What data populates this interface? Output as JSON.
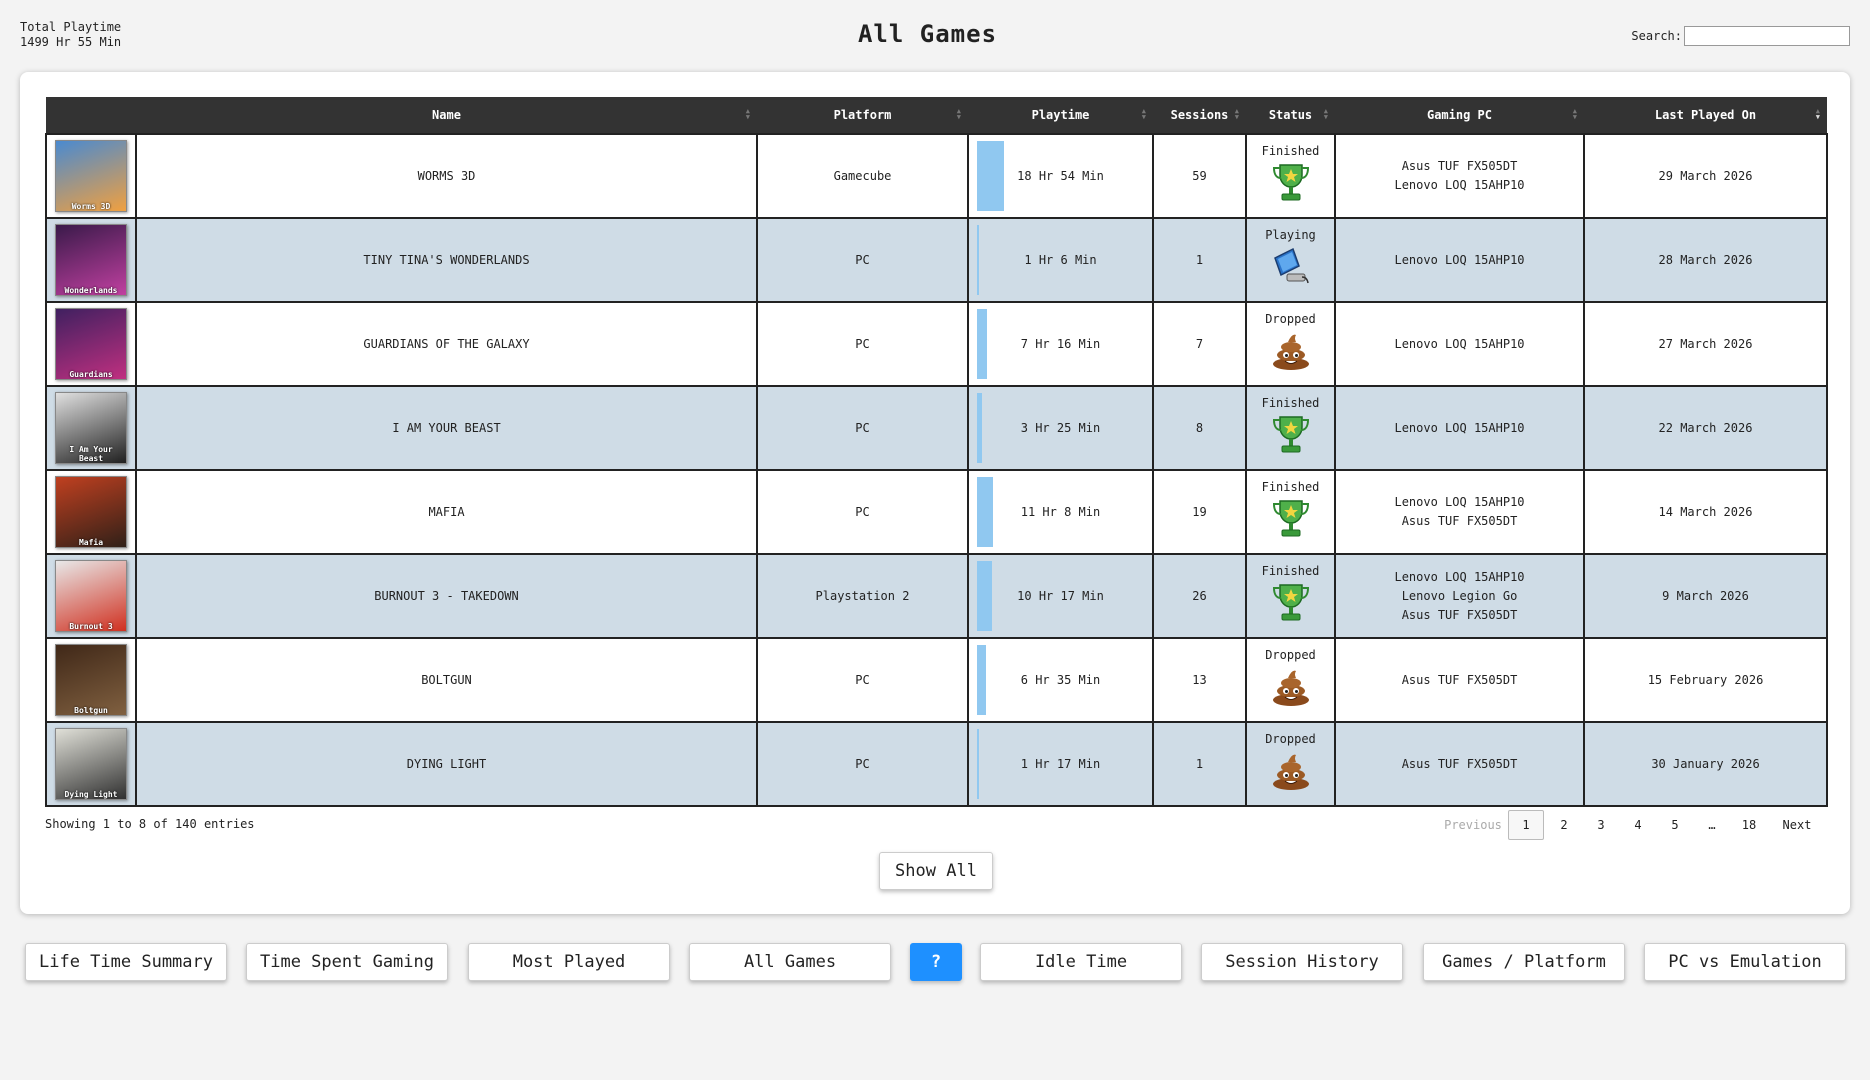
{
  "header": {
    "total_label": "Total Playtime",
    "total_value": "1499 Hr 55 Min",
    "title": "All Games",
    "search_label": "Search:",
    "search_value": ""
  },
  "table": {
    "columns": [
      "Name",
      "Platform",
      "Playtime",
      "Sessions",
      "Status",
      "Gaming PC",
      "Last Played On"
    ],
    "sorted_column": "Last Played On",
    "sort_direction": "descending",
    "max_playtime_minutes": 1134,
    "rows": [
      {
        "cover": "Worms 3D",
        "cover_colors": [
          "#4a8ad0",
          "#f0a040"
        ],
        "name": "WORMS 3D",
        "platform": "Gamecube",
        "playtime": "18 Hr 54 Min",
        "playtime_minutes": 1134,
        "sessions": "59",
        "status": "Finished",
        "status_icon": "trophy-icon",
        "pcs": [
          "Asus TUF FX505DT",
          "Lenovo LOQ 15AHP10"
        ],
        "last_played": "29 March 2026"
      },
      {
        "cover": "Wonderlands",
        "cover_colors": [
          "#3a1a4a",
          "#c040a0"
        ],
        "name": "TINY TINA'S WONDERLANDS",
        "platform": "PC",
        "playtime": "1 Hr 6 Min",
        "playtime_minutes": 66,
        "sessions": "1",
        "status": "Playing",
        "status_icon": "computer-icon",
        "pcs": [
          "Lenovo LOQ 15AHP10"
        ],
        "last_played": "28 March 2026"
      },
      {
        "cover": "Guardians",
        "cover_colors": [
          "#402060",
          "#c03080"
        ],
        "name": "GUARDIANS OF THE GALAXY",
        "platform": "PC",
        "playtime": "7 Hr 16 Min",
        "playtime_minutes": 436,
        "sessions": "7",
        "status": "Dropped",
        "status_icon": "poop-icon",
        "pcs": [
          "Lenovo LOQ 15AHP10"
        ],
        "last_played": "27 March 2026"
      },
      {
        "cover": "I Am Your Beast",
        "cover_colors": [
          "#e0e0e0",
          "#202020"
        ],
        "name": "I AM YOUR BEAST",
        "platform": "PC",
        "playtime": "3 Hr 25 Min",
        "playtime_minutes": 205,
        "sessions": "8",
        "status": "Finished",
        "status_icon": "trophy-icon",
        "pcs": [
          "Lenovo LOQ 15AHP10"
        ],
        "last_played": "22 March 2026"
      },
      {
        "cover": "Mafia",
        "cover_colors": [
          "#c04020",
          "#302018"
        ],
        "name": "MAFIA",
        "platform": "PC",
        "playtime": "11 Hr 8 Min",
        "playtime_minutes": 668,
        "sessions": "19",
        "status": "Finished",
        "status_icon": "trophy-icon",
        "pcs": [
          "Lenovo LOQ 15AHP10",
          "Asus TUF FX505DT"
        ],
        "last_played": "14 March 2026"
      },
      {
        "cover": "Burnout 3",
        "cover_colors": [
          "#e8e8e8",
          "#d03020"
        ],
        "name": "BURNOUT 3 - TAKEDOWN",
        "platform": "Playstation 2",
        "playtime": "10 Hr 17 Min",
        "playtime_minutes": 617,
        "sessions": "26",
        "status": "Finished",
        "status_icon": "trophy-icon",
        "pcs": [
          "Lenovo LOQ 15AHP10",
          "Lenovo Legion Go",
          "Asus TUF FX505DT"
        ],
        "last_played": "9 March 2026"
      },
      {
        "cover": "Boltgun",
        "cover_colors": [
          "#402818",
          "#806040"
        ],
        "name": "BOLTGUN",
        "platform": "PC",
        "playtime": "6 Hr 35 Min",
        "playtime_minutes": 395,
        "sessions": "13",
        "status": "Dropped",
        "status_icon": "poop-icon",
        "pcs": [
          "Asus TUF FX505DT"
        ],
        "last_played": "15 February 2026"
      },
      {
        "cover": "Dying Light",
        "cover_colors": [
          "#e0e0d8",
          "#303030"
        ],
        "name": "DYING LIGHT",
        "platform": "PC",
        "playtime": "1 Hr 17 Min",
        "playtime_minutes": 77,
        "sessions": "1",
        "status": "Dropped",
        "status_icon": "poop-icon",
        "pcs": [
          "Asus TUF FX505DT"
        ],
        "last_played": "30 January 2026"
      }
    ]
  },
  "footer": {
    "info": "Showing 1 to 8 of 140 entries",
    "pager": {
      "previous": "Previous",
      "pages": [
        "1",
        "2",
        "3",
        "4",
        "5",
        "…",
        "18"
      ],
      "current": "1",
      "next": "Next"
    },
    "show_all": "Show All"
  },
  "nav": [
    "Life Time Summary",
    "Time Spent Gaming",
    "Most Played",
    "All Games",
    "?",
    "Idle Time",
    "Session History",
    "Games / Platform",
    "PC vs Emulation"
  ],
  "colors": {
    "header_bg": "#333333",
    "alt_row": "#cfdce6",
    "playtime_bar": "#90c8f0",
    "help_button": "#1e90ff"
  }
}
